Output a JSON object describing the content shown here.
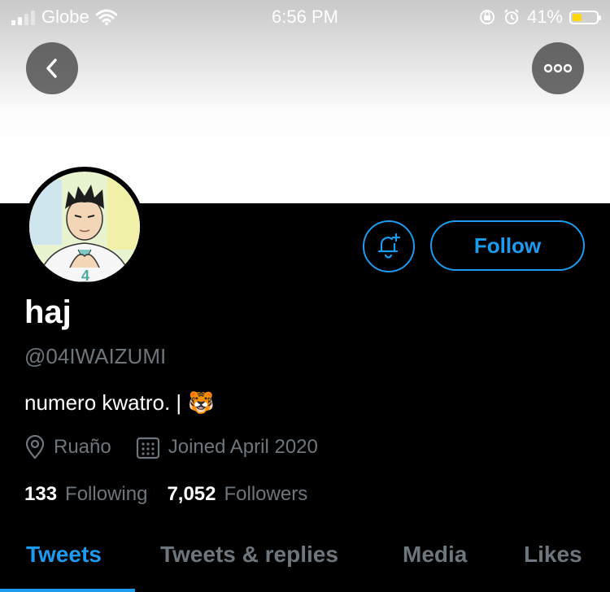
{
  "status_bar": {
    "carrier": "Globe",
    "time": "6:56 PM",
    "battery_percent": "41%",
    "signal_icon": "signal-bars-icon",
    "wifi_icon": "wifi-icon",
    "orientation_lock_icon": "orientation-lock-icon",
    "alarm_icon": "alarm-icon",
    "battery_level": 0.41,
    "battery_color": "#ffd60a"
  },
  "header": {
    "back_icon": "chevron-left-icon",
    "more_icon": "ellipsis-icon"
  },
  "profile": {
    "display_name": "haj",
    "handle": "@04IWAIZUMI",
    "bio": "numero kwatro. |",
    "bio_emoji": "🐯",
    "location": "Ruaño",
    "joined": "Joined April 2020",
    "following_count": "133",
    "following_label": "Following",
    "followers_count": "7,052",
    "followers_label": "Followers"
  },
  "actions": {
    "follow_label": "Follow",
    "notify_icon": "bell-plus-icon"
  },
  "tabs": [
    {
      "label": "Tweets",
      "active": true
    },
    {
      "label": "Tweets & replies",
      "active": false
    },
    {
      "label": "Media",
      "active": false
    },
    {
      "label": "Likes",
      "active": false
    }
  ],
  "colors": {
    "accent": "#1d9bf0",
    "secondary_text": "#6e767d",
    "background": "#000000"
  }
}
